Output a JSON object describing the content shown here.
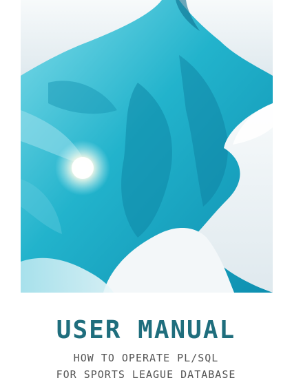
{
  "colors": {
    "title": "#1f6e7d",
    "subtitle": "#555555",
    "water": "#22b3cc",
    "snow": "#eef3f6"
  },
  "cover": {
    "title": "USER MANUAL",
    "subtitle_lines": [
      "HOW TO OPERATE PL/SQL",
      "FOR SPORTS LEAGUE DATABASE"
    ]
  }
}
